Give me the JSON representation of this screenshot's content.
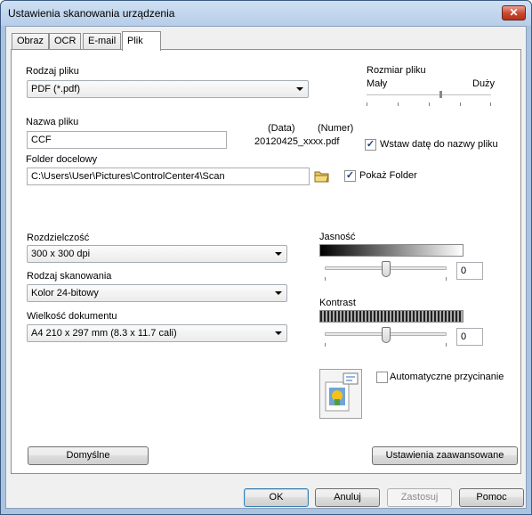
{
  "window": {
    "title": "Ustawienia skanowania urządzenia",
    "close_glyph": "✕"
  },
  "tabs": [
    {
      "label": "Obraz",
      "active": false
    },
    {
      "label": "OCR",
      "active": false
    },
    {
      "label": "E-mail",
      "active": false
    },
    {
      "label": "Plik",
      "active": true
    }
  ],
  "file_type": {
    "label": "Rodzaj pliku",
    "value": "PDF (*.pdf)"
  },
  "file_size": {
    "label": "Rozmiar pliku",
    "min_label": "Mały",
    "max_label": "Duży",
    "level": 0.6
  },
  "file_name": {
    "label": "Nazwa pliku",
    "value": "CCF",
    "date_header": "(Data)",
    "number_header": "(Numer)",
    "preview": "20120425_xxxx.pdf",
    "insert_date": {
      "label": "Wstaw datę do nazwy pliku",
      "checked": true
    }
  },
  "destination": {
    "label": "Folder docelowy",
    "value": "C:\\Users\\User\\Pictures\\ControlCenter4\\Scan",
    "folder_icon": "folder-icon",
    "show_folder": {
      "label": "Pokaż Folder",
      "checked": true
    }
  },
  "resolution": {
    "label": "Rozdzielczość",
    "value": "300 x 300 dpi"
  },
  "scan_type": {
    "label": "Rodzaj skanowania",
    "value": "Kolor 24-bitowy"
  },
  "document_size": {
    "label": "Wielkość dokumentu",
    "value": "A4 210 x 297 mm (8.3 x 11.7 cali)"
  },
  "brightness": {
    "label": "Jasność",
    "value": "0",
    "level": 0.5
  },
  "contrast": {
    "label": "Kontrast",
    "value": "0",
    "level": 0.5
  },
  "auto_crop": {
    "label": "Automatyczne przycinanie",
    "checked": false,
    "icon": "auto-crop-icon"
  },
  "buttons": {
    "defaults": "Domyślne",
    "advanced": "Ustawienia zaawansowane",
    "ok": "OK",
    "cancel": "Anuluj",
    "apply": "Zastosuj",
    "help": "Pomoc"
  }
}
